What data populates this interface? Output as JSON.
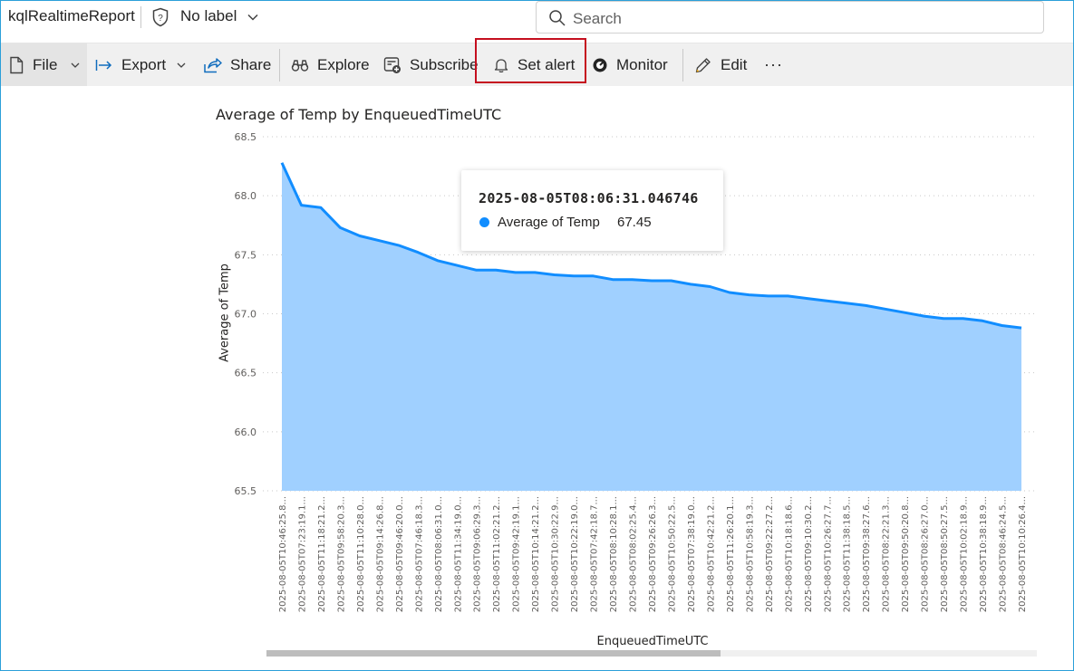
{
  "header": {
    "report_name": "kqlRealtimeReport",
    "sensitivity_label": "No label",
    "search_placeholder": "Search"
  },
  "toolbar": {
    "file": "File",
    "export": "Export",
    "share": "Share",
    "explore": "Explore",
    "subscribe": "Subscribe",
    "set_alert": "Set alert",
    "monitor": "Monitor",
    "edit": "Edit",
    "more": "···"
  },
  "colors": {
    "series": "#118dff",
    "area_fill": "#a0d0ff",
    "highlight_box": "#c50f1f"
  },
  "tooltip": {
    "title": "2025-08-05T08:06:31.046746",
    "series": "Average of Temp",
    "value": "67.45"
  },
  "chart_data": {
    "type": "area",
    "title": "Average of Temp by EnqueuedTimeUTC",
    "xlabel": "EnqueuedTimeUTC",
    "ylabel": "Average of Temp",
    "ylim": [
      65.5,
      68.5
    ],
    "yticks": [
      "68.5",
      "68.0",
      "67.5",
      "67.0",
      "66.5",
      "66.0",
      "65.5"
    ],
    "grid": true,
    "categories": [
      "2025-08-05T10:46:25.8...",
      "2025-08-05T07:23:19.1...",
      "2025-08-05T11:18:21.2...",
      "2025-08-05T09:58:20.3...",
      "2025-08-05T11:10:28.0...",
      "2025-08-05T09:14:26.8...",
      "2025-08-05T09:46:20.0...",
      "2025-08-05T07:46:18.3...",
      "2025-08-05T08:06:31.0...",
      "2025-08-05T11:34:19.0...",
      "2025-08-05T09:06:29.3...",
      "2025-08-05T11:02:21.2...",
      "2025-08-05T09:42:19.1...",
      "2025-08-05T10:14:21.2...",
      "2025-08-05T10:30:22.9...",
      "2025-08-05T10:22:19.0...",
      "2025-08-05T07:42:18.7...",
      "2025-08-05T08:10:28.1...",
      "2025-08-05T08:02:25.4...",
      "2025-08-05T09:26:26.3...",
      "2025-08-05T10:50:22.5...",
      "2025-08-05T07:38:19.0...",
      "2025-08-05T10:42:21.2...",
      "2025-08-05T11:26:20.1...",
      "2025-08-05T10:58:19.3...",
      "2025-08-05T09:22:27.2...",
      "2025-08-05T10:18:18.6...",
      "2025-08-05T09:10:30.2...",
      "2025-08-05T10:26:27.7...",
      "2025-08-05T11:38:18.5...",
      "2025-08-05T09:38:27.6...",
      "2025-08-05T08:22:21.3...",
      "2025-08-05T09:50:20.8...",
      "2025-08-05T08:26:27.0...",
      "2025-08-05T08:50:27.5...",
      "2025-08-05T10:02:18.9...",
      "2025-08-05T10:38:18.9...",
      "2025-08-05T08:46:24.5...",
      "2025-08-05T10:10:26.4..."
    ],
    "series": [
      {
        "name": "Average of Temp",
        "values": [
          68.28,
          67.92,
          67.9,
          67.73,
          67.66,
          67.62,
          67.58,
          67.52,
          67.45,
          67.41,
          67.37,
          67.37,
          67.35,
          67.35,
          67.33,
          67.32,
          67.32,
          67.29,
          67.29,
          67.28,
          67.28,
          67.25,
          67.23,
          67.18,
          67.16,
          67.15,
          67.15,
          67.13,
          67.11,
          67.09,
          67.07,
          67.04,
          67.01,
          66.98,
          66.96,
          66.96,
          66.94,
          66.9,
          66.88
        ]
      }
    ]
  }
}
